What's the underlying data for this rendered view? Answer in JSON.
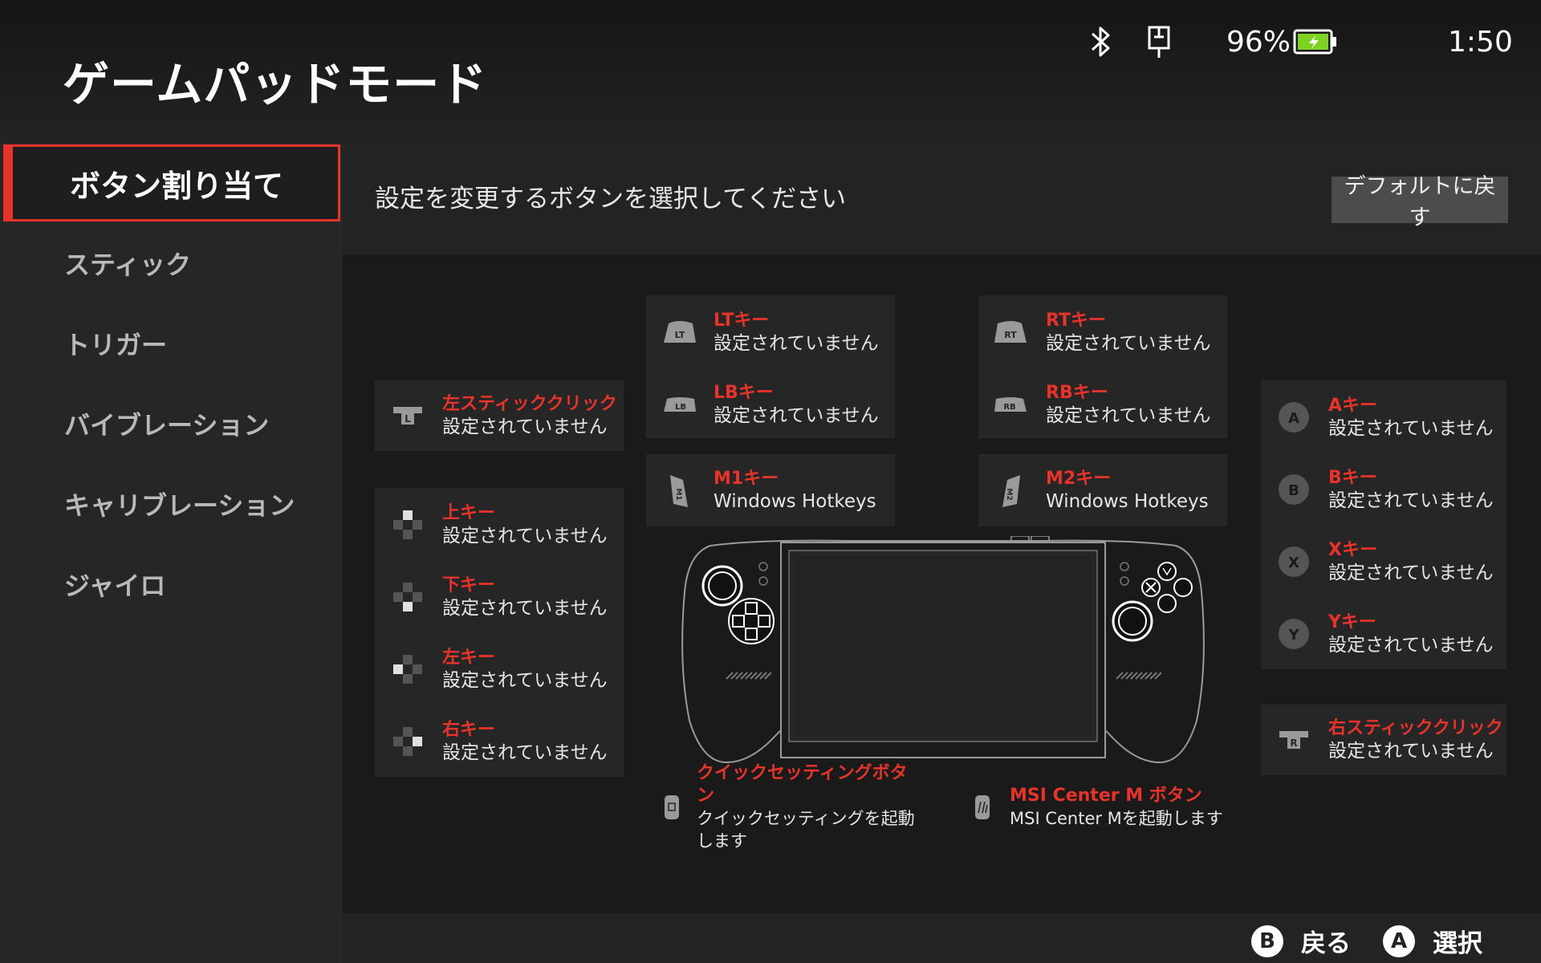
{
  "header": {
    "title": "ゲームパッドモード",
    "battery_percent": "96%",
    "time": "1:50"
  },
  "sidebar": {
    "items": [
      {
        "label": "ボタン割り当て"
      },
      {
        "label": "スティック"
      },
      {
        "label": "トリガー"
      },
      {
        "label": "バイブレーション"
      },
      {
        "label": "キャリブレーション"
      },
      {
        "label": "ジャイロ"
      }
    ]
  },
  "main": {
    "instruction": "設定を変更するボタンを選択してください",
    "default_button": "デフォルトに戻す"
  },
  "mappings": {
    "left_stick_click": {
      "label": "左スティッククリック",
      "value": "設定されていません"
    },
    "up": {
      "label": "上キー",
      "value": "設定されていません"
    },
    "down": {
      "label": "下キー",
      "value": "設定されていません"
    },
    "left": {
      "label": "左キー",
      "value": "設定されていません"
    },
    "right": {
      "label": "右キー",
      "value": "設定されていません"
    },
    "lt": {
      "label": "LTキー",
      "value": "設定されていません"
    },
    "lb": {
      "label": "LBキー",
      "value": "設定されていません"
    },
    "m1": {
      "label": "M1キー",
      "value": "Windows Hotkeys"
    },
    "rt": {
      "label": "RTキー",
      "value": "設定されていません"
    },
    "rb": {
      "label": "RBキー",
      "value": "設定されていません"
    },
    "m2": {
      "label": "M2キー",
      "value": "Windows Hotkeys"
    },
    "a": {
      "label": "Aキー",
      "value": "設定されていません"
    },
    "b": {
      "label": "Bキー",
      "value": "設定されていません"
    },
    "x": {
      "label": "Xキー",
      "value": "設定されていません"
    },
    "y": {
      "label": "Yキー",
      "value": "設定されていません"
    },
    "right_stick_click": {
      "label": "右スティッククリック",
      "value": "設定されていません"
    },
    "quick_settings": {
      "label": "クイックセッティングボタン",
      "value": "クイックセッティングを起動します"
    },
    "msi_center": {
      "label": "MSI Center M ボタン",
      "value": "MSI Center Mを起動します"
    }
  },
  "glyphs": {
    "lt": "LT",
    "lb": "LB",
    "rt": "RT",
    "rb": "RB",
    "m1": "M1",
    "m2": "M2",
    "l": "L",
    "r": "R",
    "a": "A",
    "b": "B",
    "x": "X",
    "y": "Y"
  },
  "footer": {
    "back_key": "B",
    "back_label": "戻る",
    "select_key": "A",
    "select_label": "選択"
  },
  "colors": {
    "accent": "#e8332a",
    "battery": "#7ed321"
  }
}
